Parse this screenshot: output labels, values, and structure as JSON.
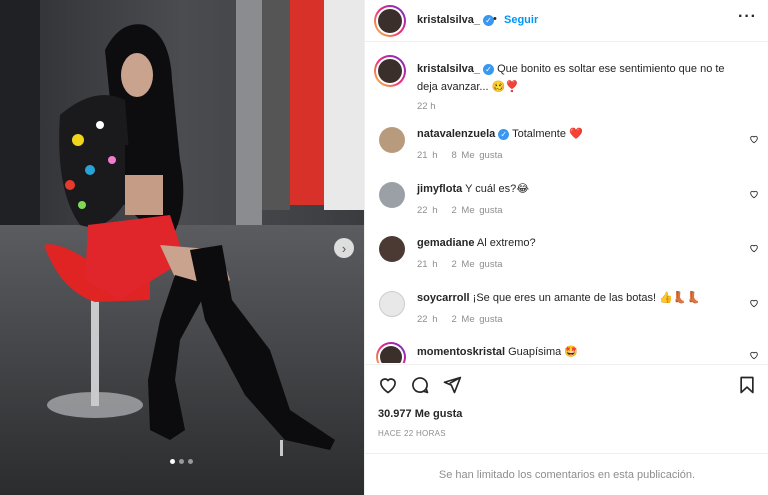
{
  "post": {
    "username": "kristalsilva_",
    "follow_label": "Seguir",
    "caption_user": "kristalsilva_",
    "caption_text": "Que bonito es soltar ese sentimiento que no te deja avanzar... 🥴❣️",
    "caption_time": "22 h",
    "likes": "30.977 Me gusta",
    "time_ago": "HACE 22 HORAS",
    "comments_limited": "Se han limitado los comentarios en esta publicación."
  },
  "comments": [
    {
      "user": "natavalenzuela",
      "verified": true,
      "text": "Totalmente ❤️",
      "time": "21 h",
      "likes": "8 Me gusta"
    },
    {
      "user": "jimyflota",
      "verified": false,
      "text": "Y cuál es?😂",
      "time": "22 h",
      "likes": "2 Me gusta"
    },
    {
      "user": "gemadiane",
      "verified": false,
      "text": "Al extremo?",
      "time": "21 h",
      "likes": "2 Me gusta"
    },
    {
      "user": "soycarroll",
      "verified": false,
      "text": "¡Se que eres un amante de las botas! 👍👢👢",
      "time": "22 h",
      "likes": "2 Me gusta"
    },
    {
      "user": "momentoskristal",
      "verified": false,
      "text": "Guapísima 🤩",
      "time": "",
      "likes": ""
    }
  ],
  "icons": {
    "more": "more-horizontal-icon",
    "like": "heart-outline-icon",
    "comment": "comment-bubble-icon",
    "share": "paper-plane-icon",
    "save": "bookmark-icon",
    "next": "chevron-right-icon"
  },
  "colors": {
    "accent": "#0095f6",
    "verified": "#3897f0",
    "heart_red": "#ed4956"
  },
  "carousel": {
    "slides": 3,
    "active": 1
  }
}
